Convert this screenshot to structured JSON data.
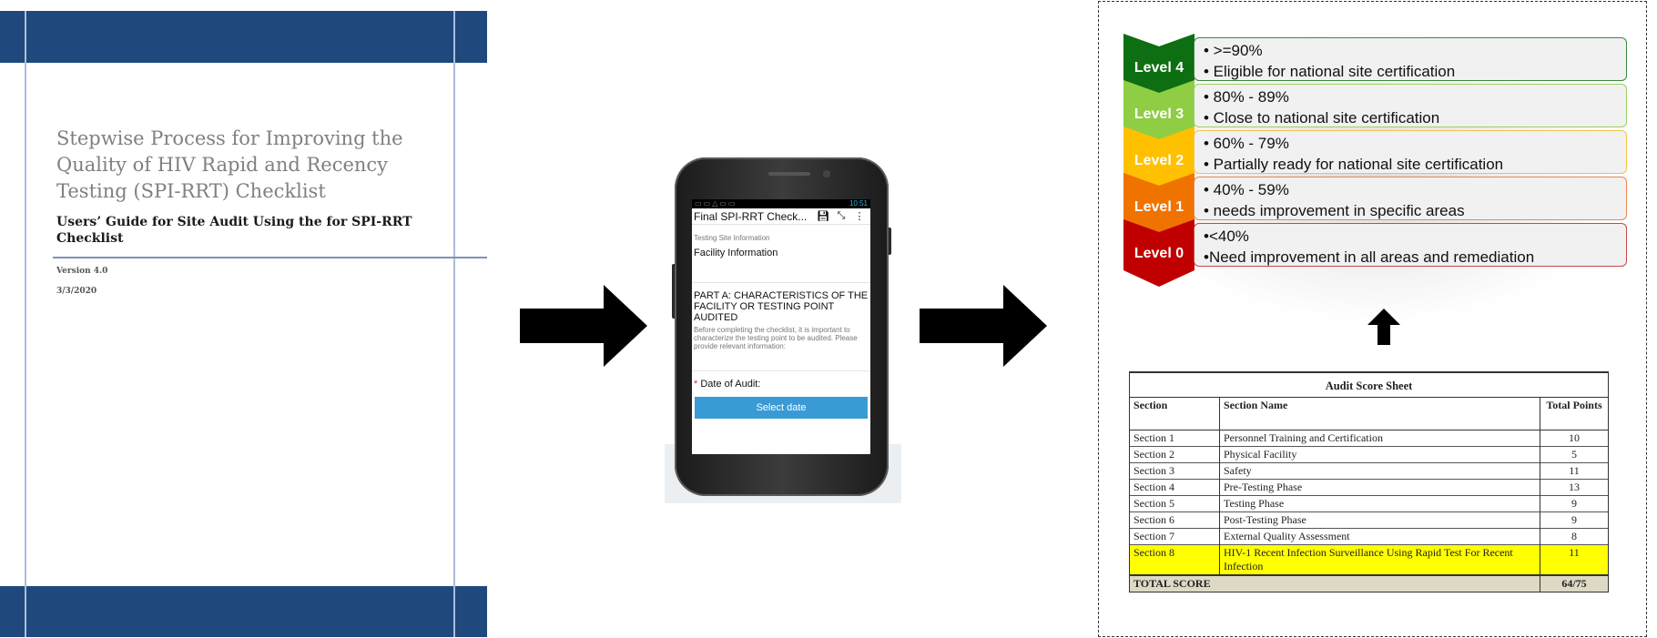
{
  "document": {
    "title": "Stepwise Process for Improving the Quality of HIV Rapid and Recency Testing (SPI-RRT) Checklist",
    "subtitle": "Users’ Guide for Site Audit Using the for SPI-RRT Checklist",
    "version": "Version 4.0",
    "date": "3/3/2020",
    "colors": {
      "band": "#1f487d"
    }
  },
  "phone": {
    "status_time": "10:51",
    "app_title": "Final SPI-RRT Check...",
    "toolbar_icons": [
      "save-icon",
      "expand-icon",
      "more-vert-icon"
    ],
    "section_label": "Testing Site Information",
    "facility_heading": "Facility Information",
    "part_a_heading": "PART A: CHARACTERISTICS OF THE FACILITY OR TESTING POINT AUDITED",
    "part_a_description": "Before completing the checklist, it is important to characterize the testing point to be audited. Please provide relevant information:",
    "required_marker": "*",
    "date_label": "Date of Audit:",
    "select_date_button": "Select date",
    "colors": {
      "button": "#3a9ad5"
    }
  },
  "levels": [
    {
      "label": "Level 4",
      "line1": "• >=90%",
      "line2": "• Eligible for national site certification",
      "color": "#0d6e12",
      "border": "#3a8a3a"
    },
    {
      "label": "Level 3",
      "line1": "• 80% - 89%",
      "line2": "• Close to national site certification",
      "color": "#8fcd45",
      "border": "#9bcf62"
    },
    {
      "label": "Level 2",
      "line1": "• 60% - 79%",
      "line2": "• Partially ready for national site certification",
      "color": "#ffc000",
      "border": "#f2c447"
    },
    {
      "label": "Level 1",
      "line1": "• 40% - 59%",
      "line2": "• needs improvement in specific areas",
      "color": "#f07300",
      "border": "#e8894a"
    },
    {
      "label": "Level 0",
      "line1": "•<40%",
      "line2": "•Need improvement in all areas and remediation",
      "color": "#c00000",
      "border": "#c84848"
    }
  ],
  "score_sheet": {
    "caption": "Audit Score Sheet",
    "headers": {
      "section": "Section",
      "name": "Section Name",
      "points": "Total Points"
    },
    "rows": [
      {
        "section": "Section 1",
        "name": "Personnel Training and Certification",
        "points": "10"
      },
      {
        "section": "Section 2",
        "name": "Physical Facility",
        "points": "5"
      },
      {
        "section": "Section 3",
        "name": "Safety",
        "points": "11"
      },
      {
        "section": "Section 4",
        "name": "Pre-Testing Phase",
        "points": "13"
      },
      {
        "section": "Section 5",
        "name": "Testing Phase",
        "points": "9"
      },
      {
        "section": "Section 6",
        "name": "Post-Testing Phase",
        "points": "9"
      },
      {
        "section": "Section 7",
        "name": "External Quality Assessment",
        "points": "8"
      },
      {
        "section": "Section 8",
        "name": "HIV-1 Recent Infection Surveillance Using Rapid Test For Recent Infection",
        "points": "11",
        "highlight": true
      }
    ],
    "total": {
      "label": "TOTAL SCORE",
      "points": "64/75"
    },
    "colors": {
      "highlight": "#ffff00",
      "total": "#ddd9c4"
    }
  }
}
